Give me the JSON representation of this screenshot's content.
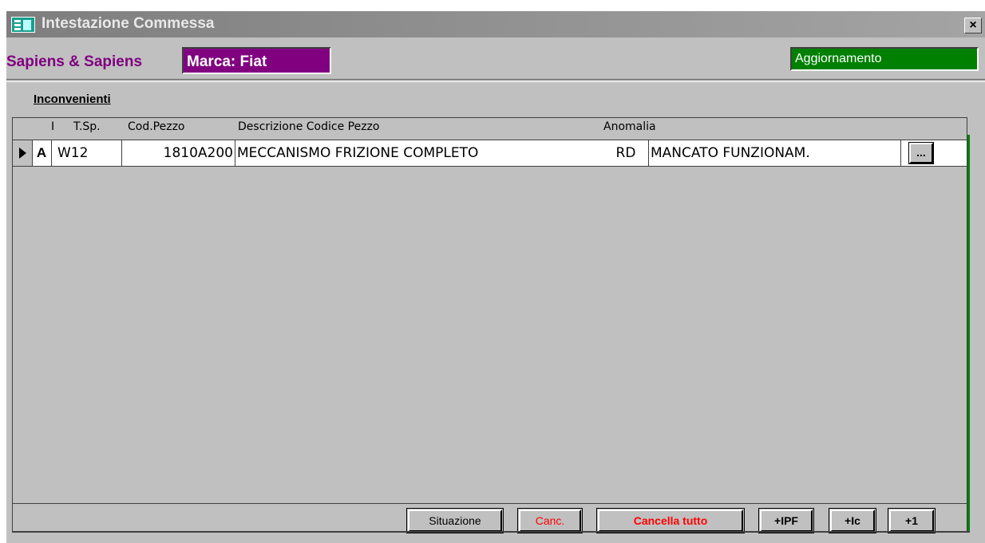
{
  "window": {
    "title": "Intestazione Commessa",
    "close_label": "×"
  },
  "header": {
    "company": "Sapiens & Sapiens",
    "marca": "Marca: Fiat",
    "status": "Aggiornamento"
  },
  "section": {
    "label": "Inconvenienti "
  },
  "grid": {
    "columns": [
      "I",
      "T.Sp.",
      "Cod.Pezzo",
      "Descrizione Codice Pezzo",
      "Anomalia"
    ],
    "rows": [
      {
        "i": "A",
        "tsp": "W12",
        "cod_pezzo": "1810A200",
        "descrizione": "MECCANISMO FRIZIONE COMPLETO",
        "anomalia_code": "RD",
        "anomalia_desc": "MANCATO FUNZIONAM.",
        "lookup_label": "..."
      }
    ]
  },
  "buttons": {
    "situazione": "Situazione",
    "canc": "Canc.",
    "cancella_tutto": "Cancella tutto",
    "ipf": "+IPF",
    "ic": "+Ic",
    "plus1": "+1"
  },
  "colors": {
    "brand_purple": "#800080",
    "status_green": "#008000",
    "danger_red": "#ff0000",
    "window_gray": "#c0c0c0"
  }
}
